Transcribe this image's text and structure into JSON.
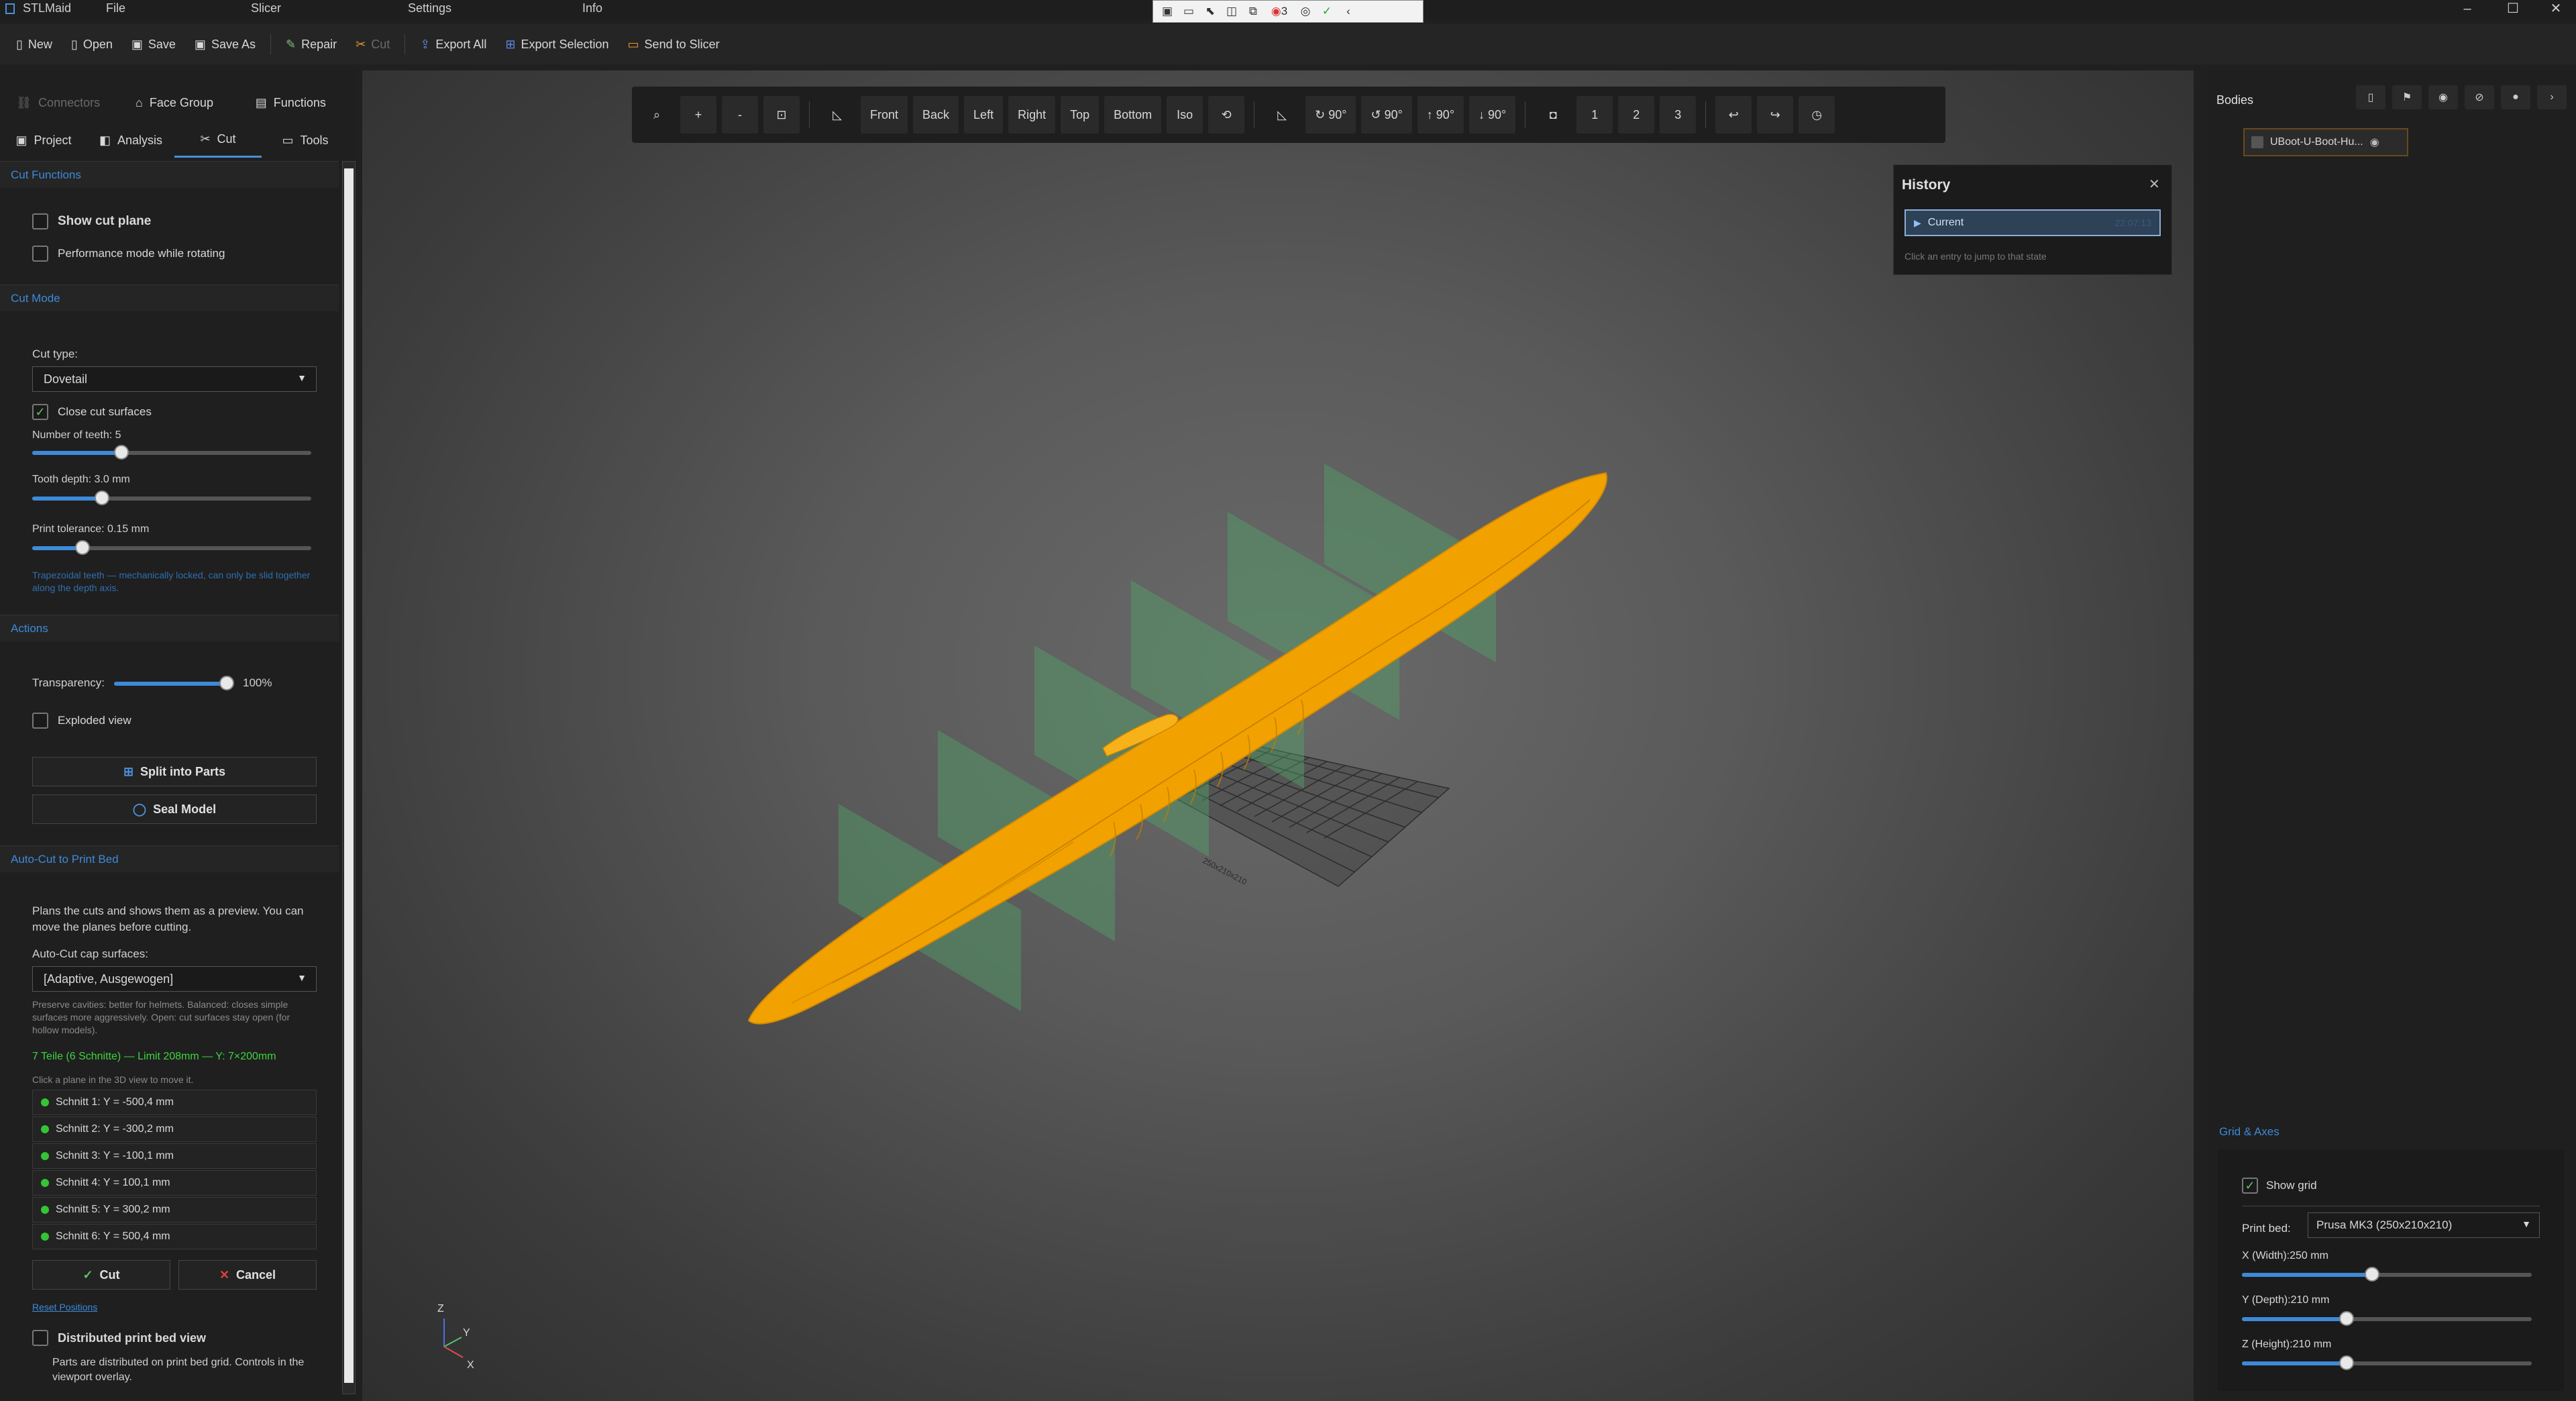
{
  "app": {
    "name": "STLMaid"
  },
  "menubar": {
    "file": "File",
    "slicer": "Slicer",
    "settings": "Settings",
    "info": "Info"
  },
  "quickbar": {
    "badge": "3"
  },
  "toolbar": {
    "new": "New",
    "open": "Open",
    "save": "Save",
    "save_as": "Save As",
    "repair": "Repair",
    "cut": "Cut",
    "export_all": "Export All",
    "export_selection": "Export Selection",
    "send_to_slicer": "Send to Slicer"
  },
  "left_tabs_row1": [
    {
      "label": "Connectors",
      "icon": "link-icon"
    },
    {
      "label": "Face Group",
      "icon": "tag-icon"
    },
    {
      "label": "Functions",
      "icon": "functions-icon"
    }
  ],
  "left_tabs_row2": [
    {
      "label": "Project",
      "icon": "project-icon"
    },
    {
      "label": "Analysis",
      "icon": "analysis-icon"
    },
    {
      "label": "Cut",
      "icon": "cut-icon"
    },
    {
      "label": "Tools",
      "icon": "tools-icon"
    }
  ],
  "cut_functions": {
    "title": "Cut Functions",
    "show_cut_plane": "Show cut plane",
    "performance_mode": "Performance mode while rotating"
  },
  "cut_mode": {
    "title": "Cut Mode",
    "cut_type_label": "Cut type:",
    "cut_type_value": "Dovetail",
    "close_cut_surfaces": "Close cut surfaces",
    "teeth_label": "Number of teeth: 5",
    "teeth_level": 0.32,
    "depth_label": "Tooth depth: 3.0 mm",
    "depth_level": 0.25,
    "tolerance_label": "Print tolerance: 0.15 mm",
    "tolerance_level": 0.18,
    "hint": "Trapezoidal teeth — mechanically locked, can only be slid together along the depth axis."
  },
  "actions": {
    "title": "Actions",
    "transparency_label": "Transparency:",
    "transparency_value": "100%",
    "transparency_level": 1.0,
    "exploded_view": "Exploded view",
    "split_into_parts": "Split into Parts",
    "seal_model": "Seal Model"
  },
  "auto_cut": {
    "title": "Auto-Cut to Print Bed",
    "description": "Plans the cuts and shows them as a preview. You can move the planes before cutting.",
    "cap_label": "Auto-Cut cap surfaces:",
    "cap_value": "[Adaptive, Ausgewogen]",
    "cap_hint": "Preserve cavities: better for helmets. Balanced: closes simple surfaces more aggressively. Open: cut surfaces stay open (for hollow models).",
    "summary": "7 Teile (6 Schnitte) — Limit 208mm — Y: 7×200mm",
    "click_hint": "Click a plane in the 3D view to move it.",
    "cuts": [
      "Schnitt 1: Y = -500,4 mm",
      "Schnitt 2: Y = -300,2 mm",
      "Schnitt 3: Y = -100,1 mm",
      "Schnitt 4: Y = 100,1 mm",
      "Schnitt 5: Y = 300,2 mm",
      "Schnitt 6: Y = 500,4 mm"
    ],
    "cut_button": "Cut",
    "cancel_button": "Cancel",
    "reset_positions": "Reset Positions",
    "distributed_view": "Distributed print bed view",
    "distributed_hint": "Parts are distributed on print bed grid. Controls in the viewport overlay."
  },
  "viewport_toolbar": {
    "zoom_in": "+",
    "zoom_out": "-",
    "fit": "⊡",
    "front": "Front",
    "back": "Back",
    "left": "Left",
    "right": "Right",
    "top": "Top",
    "bottom": "Bottom",
    "iso": "Iso",
    "reset": "⟲",
    "rot1": "↻ 90°",
    "rot2": "↺ 90°",
    "rot3": "↑ 90°",
    "rot4": "↓ 90°",
    "shot1": "1",
    "shot2": "2",
    "shot3": "3"
  },
  "history": {
    "title": "History",
    "current": "Current",
    "time": "22:07:13",
    "hint": "Click an entry to jump to that state"
  },
  "axis": {
    "z": "Z",
    "y": "Y",
    "x": "X"
  },
  "bed_label": "250x210x210",
  "bodies": {
    "title": "Bodies",
    "items": [
      {
        "name": "UBoot-U-Boot-Hu..."
      }
    ]
  },
  "grid_axes": {
    "title": "Grid & Axes",
    "show_grid": "Show grid",
    "print_bed_label": "Print bed:",
    "print_bed_value": "Prusa MK3 (250x210x210)",
    "x_label": "X (Width):250 mm",
    "x_level": 0.45,
    "y_label": "Y (Depth):210 mm",
    "y_level": 0.36,
    "z_label": "Z (Height):210 mm",
    "z_level": 0.36
  },
  "colors": {
    "accent": "#3d8ad9",
    "model": "#f2a200",
    "cut_plane": "#4fa86a",
    "ok_green": "#35c435"
  }
}
